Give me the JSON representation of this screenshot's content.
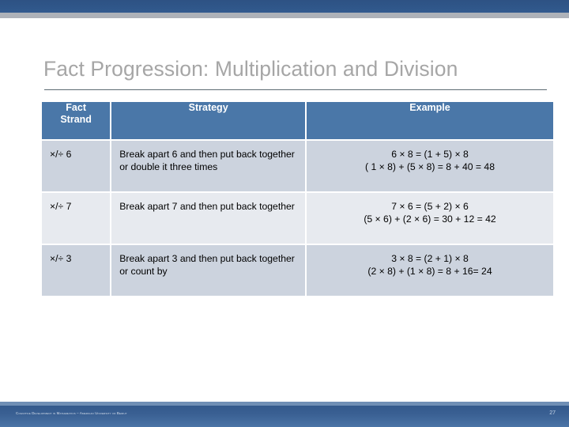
{
  "slide": {
    "title": "Fact Progression: Multiplication and Division"
  },
  "table": {
    "headers": {
      "strand": "Fact Strand",
      "strand_line1": "Fact",
      "strand_line2": "Strand",
      "strategy": "Strategy",
      "example": "Example"
    },
    "rows": [
      {
        "strand": "×/÷ 6",
        "strategy": "Break apart 6 and then put back together or double it three times",
        "example_line1": "6 × 8 = (1 + 5) × 8",
        "example_line2": "( 1 × 8) + (5 × 8) = 8 + 40 = 48"
      },
      {
        "strand": "×/÷ 7",
        "strategy": "Break apart 7 and then put back together",
        "example_line1": "7 × 6 = (5 + 2) × 6",
        "example_line2": "(5 × 6) + (2 × 6) = 30 + 12 = 42"
      },
      {
        "strand": "×/÷ 3",
        "strategy": "Break apart 3 and then put back together or count by",
        "example_line1": "3 × 8 = (2 + 1) × 8",
        "example_line2": "(2 × 8) + (1 × 8) = 8 + 16= 24"
      }
    ]
  },
  "footer": {
    "credit": "Cognitive Development in Mathematics – American University of Beirut",
    "page_number": "27"
  },
  "colors": {
    "header_blue": "#4a77a8",
    "row_shade": "#ccd3de",
    "row_light": "#e7eaef",
    "title_gray": "#a6a6a6",
    "band_blue": "#2f5689",
    "band_gray": "#aeb2b9"
  }
}
